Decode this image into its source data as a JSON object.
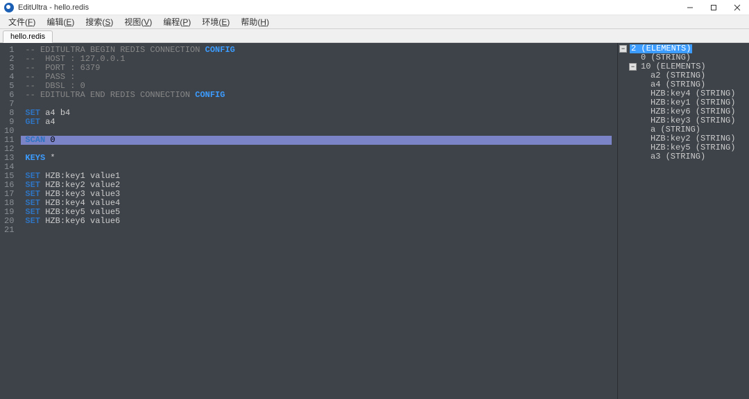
{
  "window": {
    "title": "EditUltra - hello.redis"
  },
  "menu": [
    {
      "label": "文件",
      "accel": "F"
    },
    {
      "label": "编辑",
      "accel": "E"
    },
    {
      "label": "搜索",
      "accel": "S"
    },
    {
      "label": "视图",
      "accel": "V"
    },
    {
      "label": "编程",
      "accel": "P"
    },
    {
      "label": "环境",
      "accel": "E"
    },
    {
      "label": "帮助",
      "accel": "H"
    }
  ],
  "tabs": [
    {
      "label": "hello.redis"
    }
  ],
  "editor": {
    "selected_line": 11,
    "lines": [
      {
        "n": 1,
        "tokens": [
          {
            "t": "-- EDITULTRA BEGIN REDIS CONNECTION ",
            "c": "cm"
          },
          {
            "t": "CONFIG",
            "c": "kw1"
          }
        ]
      },
      {
        "n": 2,
        "tokens": [
          {
            "t": "--  HOST : 127.0.0.1",
            "c": "cm"
          }
        ]
      },
      {
        "n": 3,
        "tokens": [
          {
            "t": "--  PORT : 6379",
            "c": "cm"
          }
        ]
      },
      {
        "n": 4,
        "tokens": [
          {
            "t": "--  PASS :",
            "c": "cm"
          }
        ]
      },
      {
        "n": 5,
        "tokens": [
          {
            "t": "--  DBSL : 0",
            "c": "cm"
          }
        ]
      },
      {
        "n": 6,
        "tokens": [
          {
            "t": "-- EDITULTRA END REDIS CONNECTION ",
            "c": "cm"
          },
          {
            "t": "CONFIG",
            "c": "kw1"
          }
        ]
      },
      {
        "n": 7,
        "tokens": []
      },
      {
        "n": 8,
        "tokens": [
          {
            "t": "SET",
            "c": "kw2"
          },
          {
            "t": " a4 b4",
            "c": ""
          }
        ]
      },
      {
        "n": 9,
        "tokens": [
          {
            "t": "GET",
            "c": "kw2"
          },
          {
            "t": " a4",
            "c": ""
          }
        ]
      },
      {
        "n": 10,
        "tokens": []
      },
      {
        "n": 11,
        "tokens": [
          {
            "t": "SCAN",
            "c": "kw2"
          },
          {
            "t": " 0",
            "c": ""
          }
        ]
      },
      {
        "n": 12,
        "tokens": []
      },
      {
        "n": 13,
        "tokens": [
          {
            "t": "KEYS",
            "c": "kw1"
          },
          {
            "t": " *",
            "c": ""
          }
        ]
      },
      {
        "n": 14,
        "tokens": []
      },
      {
        "n": 15,
        "tokens": [
          {
            "t": "SET",
            "c": "kw2"
          },
          {
            "t": " HZB:key1 value1",
            "c": ""
          }
        ]
      },
      {
        "n": 16,
        "tokens": [
          {
            "t": "SET",
            "c": "kw2"
          },
          {
            "t": " HZB:key2 value2",
            "c": ""
          }
        ]
      },
      {
        "n": 17,
        "tokens": [
          {
            "t": "SET",
            "c": "kw2"
          },
          {
            "t": " HZB:key3 value3",
            "c": ""
          }
        ]
      },
      {
        "n": 18,
        "tokens": [
          {
            "t": "SET",
            "c": "kw2"
          },
          {
            "t": " HZB:key4 value4",
            "c": ""
          }
        ]
      },
      {
        "n": 19,
        "tokens": [
          {
            "t": "SET",
            "c": "kw2"
          },
          {
            "t": " HZB:key5 value5",
            "c": ""
          }
        ]
      },
      {
        "n": 20,
        "tokens": [
          {
            "t": "SET",
            "c": "kw2"
          },
          {
            "t": " HZB:key6 value6",
            "c": ""
          }
        ]
      },
      {
        "n": 21,
        "tokens": []
      }
    ]
  },
  "tree": [
    {
      "depth": 0,
      "exp": "−",
      "label": "2 (ELEMENTS)",
      "selected": true
    },
    {
      "depth": 1,
      "exp": "",
      "label": "0 (STRING)"
    },
    {
      "depth": 1,
      "exp": "−",
      "label": "10 (ELEMENTS)"
    },
    {
      "depth": 2,
      "exp": "",
      "label": "a2 (STRING)"
    },
    {
      "depth": 2,
      "exp": "",
      "label": "a4 (STRING)"
    },
    {
      "depth": 2,
      "exp": "",
      "label": "HZB:key4 (STRING)"
    },
    {
      "depth": 2,
      "exp": "",
      "label": "HZB:key1 (STRING)"
    },
    {
      "depth": 2,
      "exp": "",
      "label": "HZB:key6 (STRING)"
    },
    {
      "depth": 2,
      "exp": "",
      "label": "HZB:key3 (STRING)"
    },
    {
      "depth": 2,
      "exp": "",
      "label": "a (STRING)"
    },
    {
      "depth": 2,
      "exp": "",
      "label": "HZB:key2 (STRING)"
    },
    {
      "depth": 2,
      "exp": "",
      "label": "HZB:key5 (STRING)"
    },
    {
      "depth": 2,
      "exp": "",
      "label": "a3 (STRING)"
    }
  ]
}
